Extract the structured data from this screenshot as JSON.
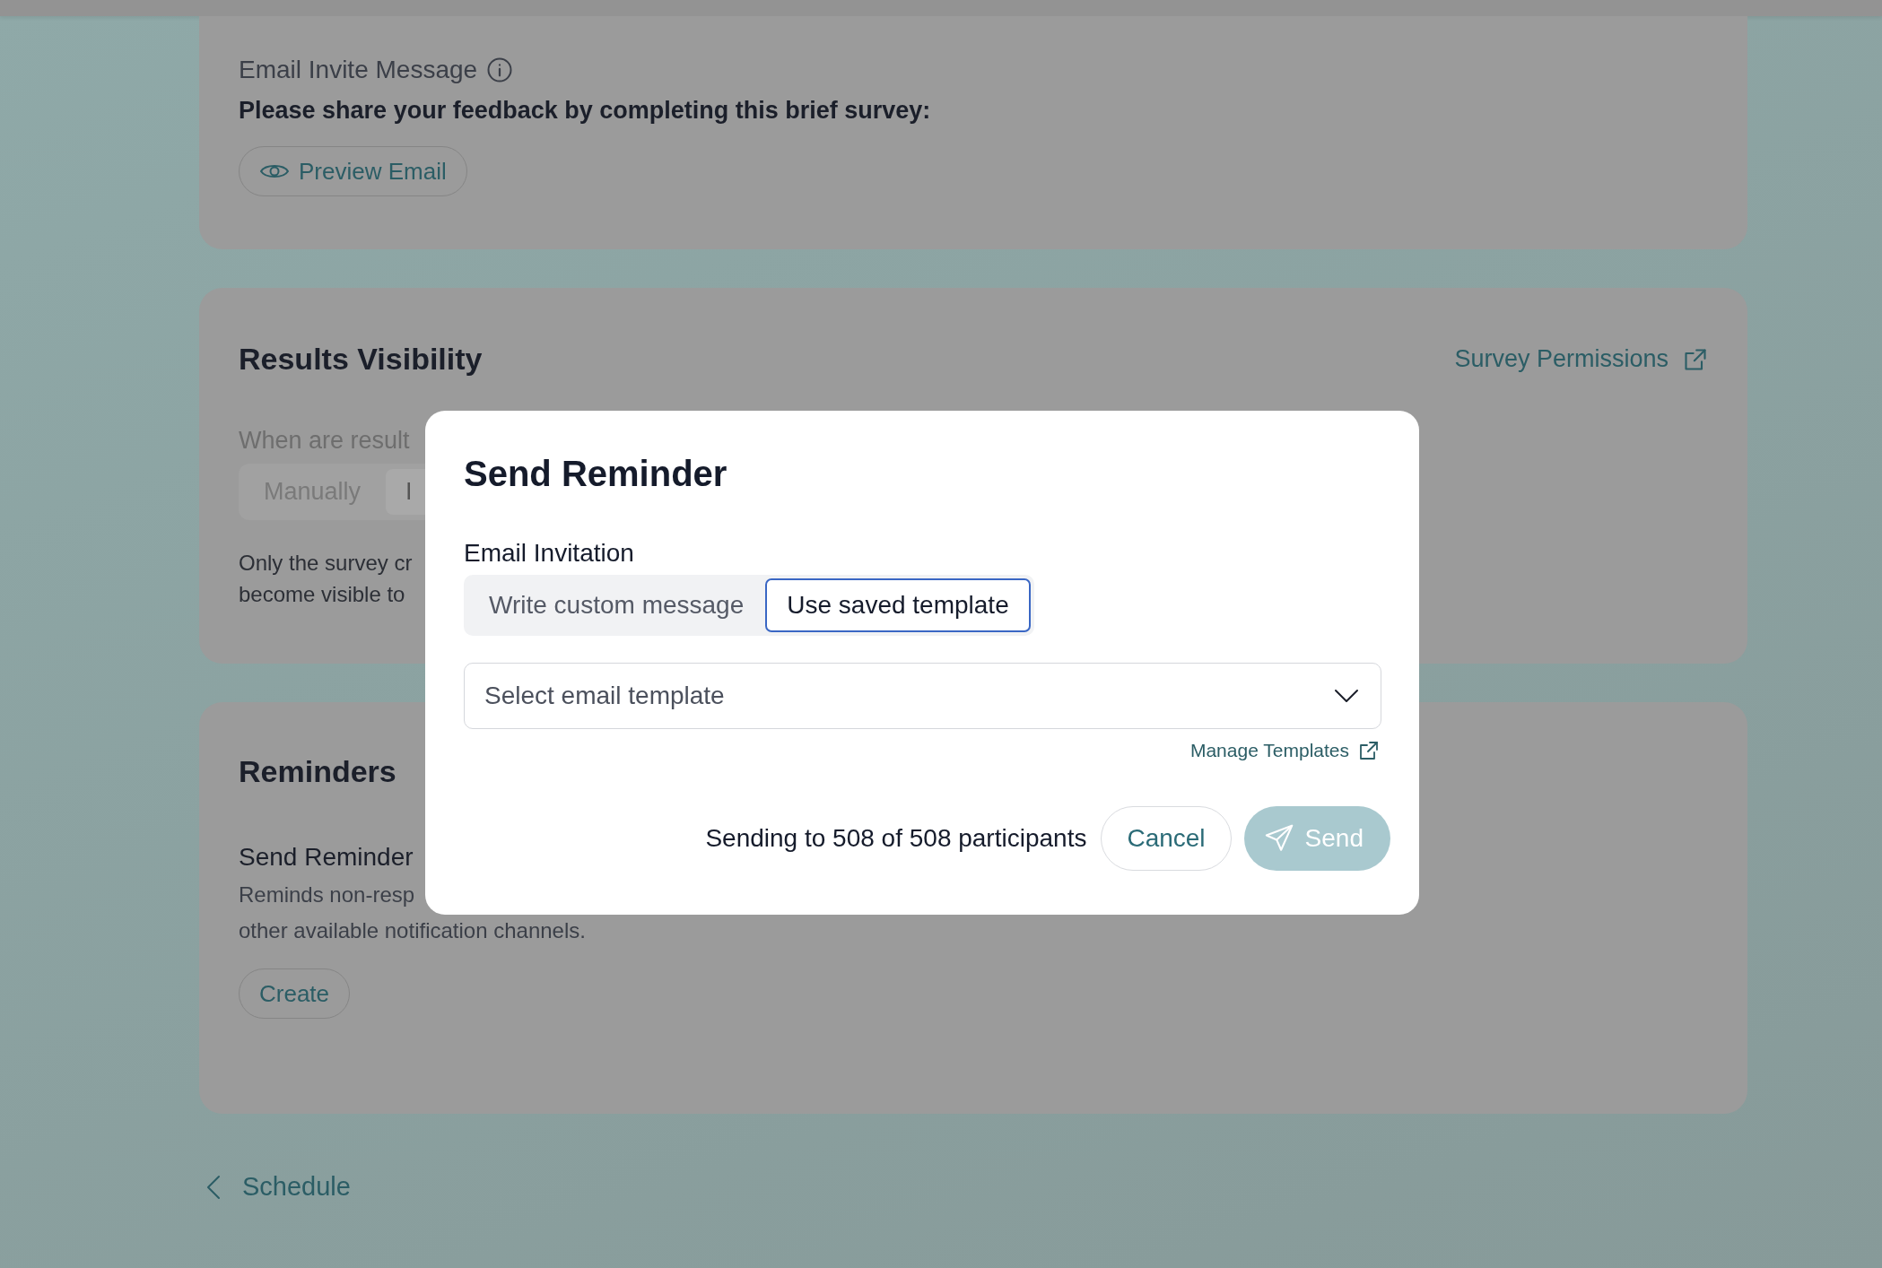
{
  "invite_card": {
    "label": "Email Invite Message",
    "message": "Please share your feedback by completing this brief survey:",
    "preview_button": "Preview Email"
  },
  "results_card": {
    "title": "Results Visibility",
    "permissions_link": "Survey Permissions",
    "question": "When are result",
    "options": [
      {
        "label": "Manually",
        "selected": false
      },
      {
        "label": "I",
        "selected": true
      }
    ],
    "note_lines": [
      "Only the survey cr",
      "become visible to"
    ]
  },
  "reminders_card": {
    "title": "Reminders",
    "item_title": "Send Reminder",
    "description_lines": [
      "Reminds non-resp",
      "other available notification channels."
    ],
    "create_button": "Create"
  },
  "back_link": "Schedule",
  "modal": {
    "title": "Send Reminder",
    "field_label": "Email Invitation",
    "modes": [
      {
        "label": "Write custom message",
        "selected": false
      },
      {
        "label": "Use saved template",
        "selected": true
      }
    ],
    "template_select": {
      "placeholder": "Select email template"
    },
    "manage_link": "Manage Templates",
    "recipients": "Sending to 508 of 508 participants",
    "cancel_button": "Cancel",
    "send_button": {
      "label": "Send",
      "disabled": true
    }
  }
}
